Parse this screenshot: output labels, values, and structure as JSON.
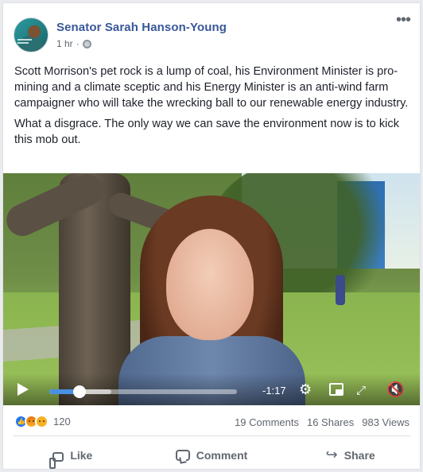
{
  "post": {
    "author": "Senator Sarah Hanson-Young",
    "time": "1 hr",
    "time_separator": "·",
    "paragraphs": [
      "Scott Morrison's pet rock is a lump of coal, his Environment Minister is pro-mining and a climate sceptic and his Energy Minister is an anti-wind farm campaigner who will take the wrecking ball to our renewable energy industry.",
      "What a disgrace. The only way we can save the environment now is to kick this mob out."
    ],
    "more_icon": "•••"
  },
  "video": {
    "time_remaining": "-1:17",
    "progress": 0.16,
    "buffered": 0.33,
    "icons": {
      "play": "play-icon",
      "settings": "gear-icon",
      "pip": "picture-in-picture-icon",
      "expand": "fullscreen-icon",
      "mute": "volume-muted-icon"
    },
    "gear_glyph": "⚙",
    "expand_glyph": "⤢",
    "mute_glyph": "🔇"
  },
  "engagement": {
    "reaction_count": "120",
    "comments": "19 Comments",
    "shares": "16 Shares",
    "views": "983 Views"
  },
  "actions": {
    "like": "Like",
    "comment": "Comment",
    "share": "Share",
    "share_glyph": "↪"
  },
  "colors": {
    "author_link": "#385898",
    "accent_blue": "#4a90e2",
    "muted_text": "#606770"
  }
}
